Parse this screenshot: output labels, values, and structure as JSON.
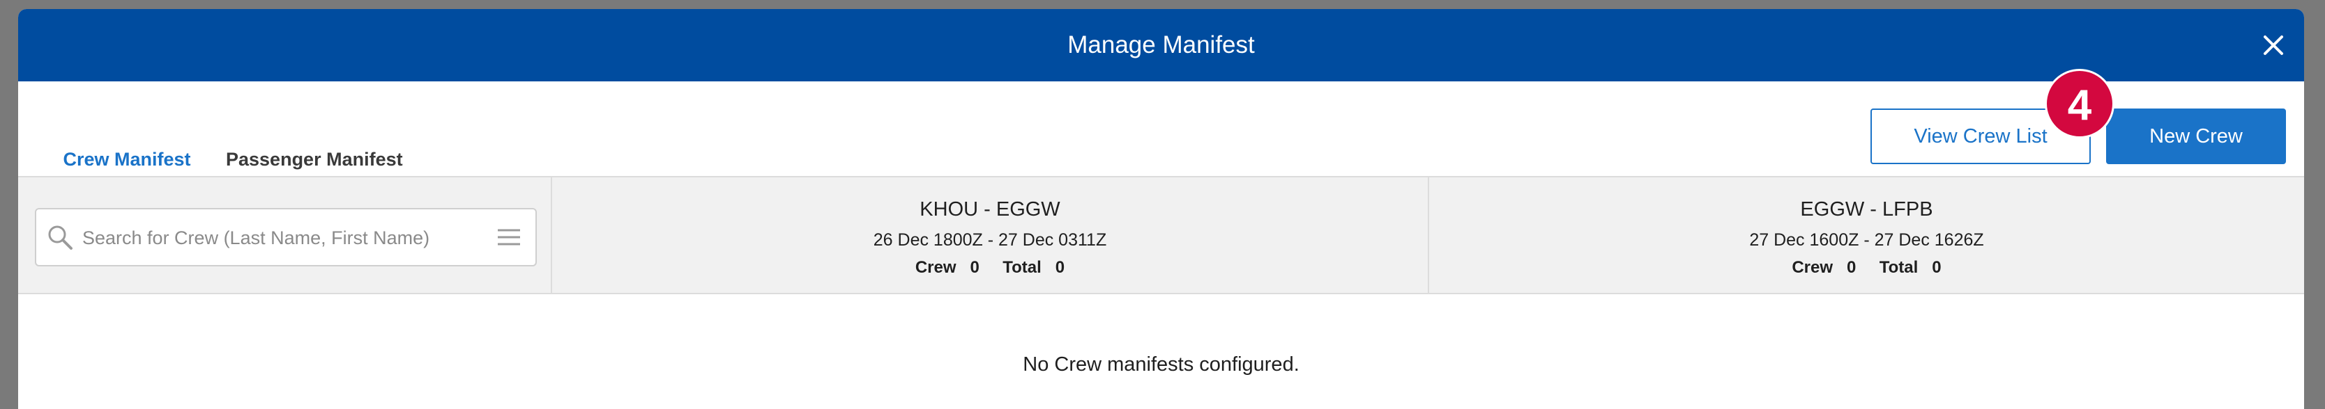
{
  "modal": {
    "title": "Manage Manifest",
    "close_icon": "close-icon"
  },
  "tabs": [
    {
      "label": "Crew Manifest",
      "active": true
    },
    {
      "label": "Passenger Manifest",
      "active": false
    }
  ],
  "actions": {
    "view_crew_list": "View Crew List",
    "new_crew": "New Crew"
  },
  "step_badge": "4",
  "search": {
    "placeholder": "Search for Crew (Last Name, First Name)",
    "value": "",
    "icon": "search-icon",
    "menu_icon": "menu-icon"
  },
  "legs": [
    {
      "route": "KHOU - EGGW",
      "time": "26 Dec 1800Z - 27 Dec 0311Z",
      "crew_label": "Crew",
      "crew_count": "0",
      "total_label": "Total",
      "total_count": "0"
    },
    {
      "route": "EGGW - LFPB",
      "time": "27 Dec 1600Z - 27 Dec 1626Z",
      "crew_label": "Crew",
      "crew_count": "0",
      "total_label": "Total",
      "total_count": "0"
    }
  ],
  "empty_message": "No Crew manifests configured.",
  "colors": {
    "header": "#004c9f",
    "accent": "#1a73c8",
    "badge": "#d3083f",
    "overlay": "#7a7a7a",
    "row_bg": "#f1f1f1"
  }
}
